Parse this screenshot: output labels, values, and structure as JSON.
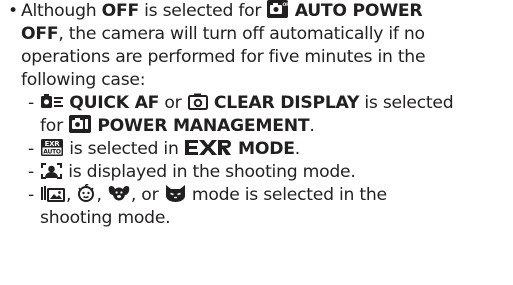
{
  "note": {
    "bullet": "•",
    "intro": {
      "l1_a": "Although ",
      "l1_b": "OFF",
      "l1_c": " is selected for ",
      "l1_d": "AUTO POWER",
      "l2_a": "OFF",
      "l2_b": ", the camera will turn off automatically if no",
      "l3": "operations are performed for five minutes in the",
      "l4": "following case:"
    },
    "cases": [
      {
        "dash": "-",
        "a": "QUICK AF",
        "b": " or ",
        "c": "CLEAR DISPLAY",
        "d": " is selected",
        "e": "for ",
        "f": "POWER MANAGEMENT",
        "g": "."
      },
      {
        "dash": "-",
        "a": " is selected in ",
        "b": "MODE",
        "c": "."
      },
      {
        "dash": "-",
        "a": " is displayed in the shooting mode."
      },
      {
        "dash": "-",
        "a": ", ",
        "b": ", ",
        "c": ", or ",
        "d": " mode is selected in the",
        "e": "shooting mode."
      }
    ],
    "icons": {
      "auto_power_off": "camera-off-menu-icon",
      "quick_af": "quick-af-icon",
      "clear_display": "clear-display-icon",
      "power_management": "power-management-icon",
      "exr_auto": "exr-auto-icon",
      "exr_logo": "exr-logo-icon",
      "portrait": "portrait-icon",
      "pro_low_light": "pro-low-light-icon",
      "baby": "baby-face-icon",
      "dog": "dog-face-icon",
      "cat": "cat-face-icon"
    }
  }
}
